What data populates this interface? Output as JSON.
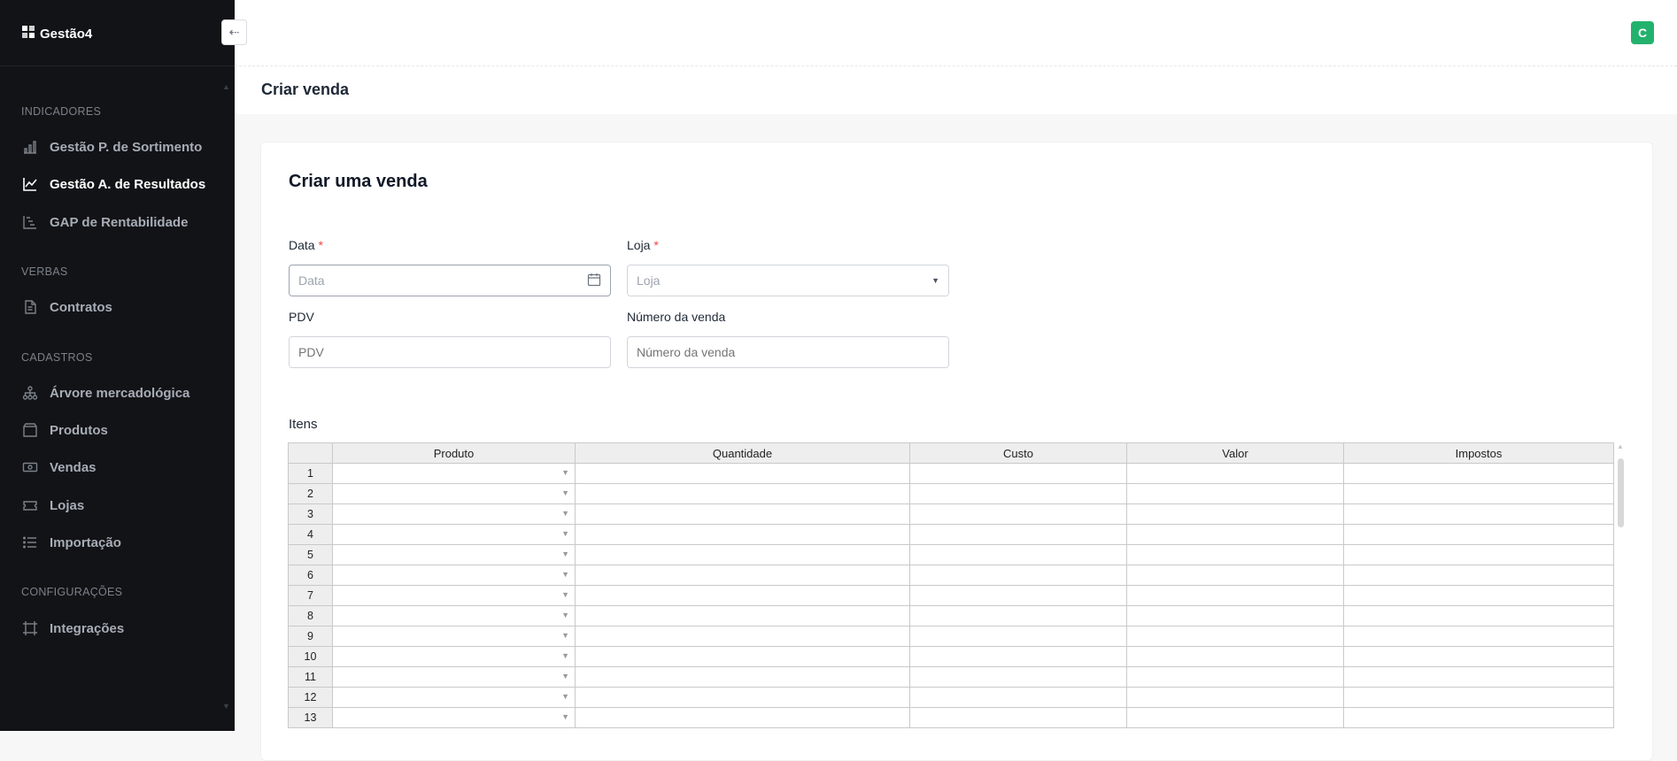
{
  "app": {
    "logo_text": "Gestão4"
  },
  "sidebar": {
    "sections": [
      {
        "title": "INDICADORES",
        "items": [
          {
            "label": "Gestão P. de Sortimento",
            "icon": "bar-chart-icon",
            "active": false
          },
          {
            "label": "Gestão A. de Resultados",
            "icon": "line-chart-icon",
            "active": true
          },
          {
            "label": "GAP de Rentabilidade",
            "icon": "waterfall-chart-icon",
            "active": false
          }
        ]
      },
      {
        "title": "VERBAS",
        "items": [
          {
            "label": "Contratos",
            "icon": "document-icon",
            "active": false
          }
        ]
      },
      {
        "title": "CADASTROS",
        "items": [
          {
            "label": "Árvore mercadológica",
            "icon": "tree-icon",
            "active": false
          },
          {
            "label": "Produtos",
            "icon": "box-icon",
            "active": false
          },
          {
            "label": "Vendas",
            "icon": "money-icon",
            "active": false
          },
          {
            "label": "Lojas",
            "icon": "ticket-icon",
            "active": false
          },
          {
            "label": "Importação",
            "icon": "list-icon",
            "active": false
          }
        ]
      },
      {
        "title": "CONFIGURAÇÕES",
        "items": [
          {
            "label": "Integrações",
            "icon": "frame-icon",
            "active": false
          }
        ]
      }
    ]
  },
  "topbar": {
    "avatar_initial": "C",
    "avatar_color": "#23b26d"
  },
  "page": {
    "title": "Criar venda"
  },
  "form": {
    "title": "Criar uma venda",
    "data": {
      "label": "Data",
      "required_mark": "*",
      "placeholder": "Data"
    },
    "loja": {
      "label": "Loja",
      "required_mark": "*",
      "placeholder": "Loja"
    },
    "pdv": {
      "label": "PDV",
      "placeholder": "PDV"
    },
    "numero": {
      "label": "Número da venda",
      "placeholder": "Número da venda"
    }
  },
  "items": {
    "label": "Itens",
    "columns": [
      "Produto",
      "Quantidade",
      "Custo",
      "Valor",
      "Impostos"
    ],
    "row_numbers": [
      "1",
      "2",
      "3",
      "4",
      "5",
      "6",
      "7",
      "8",
      "9",
      "10",
      "11",
      "12",
      "13"
    ]
  }
}
